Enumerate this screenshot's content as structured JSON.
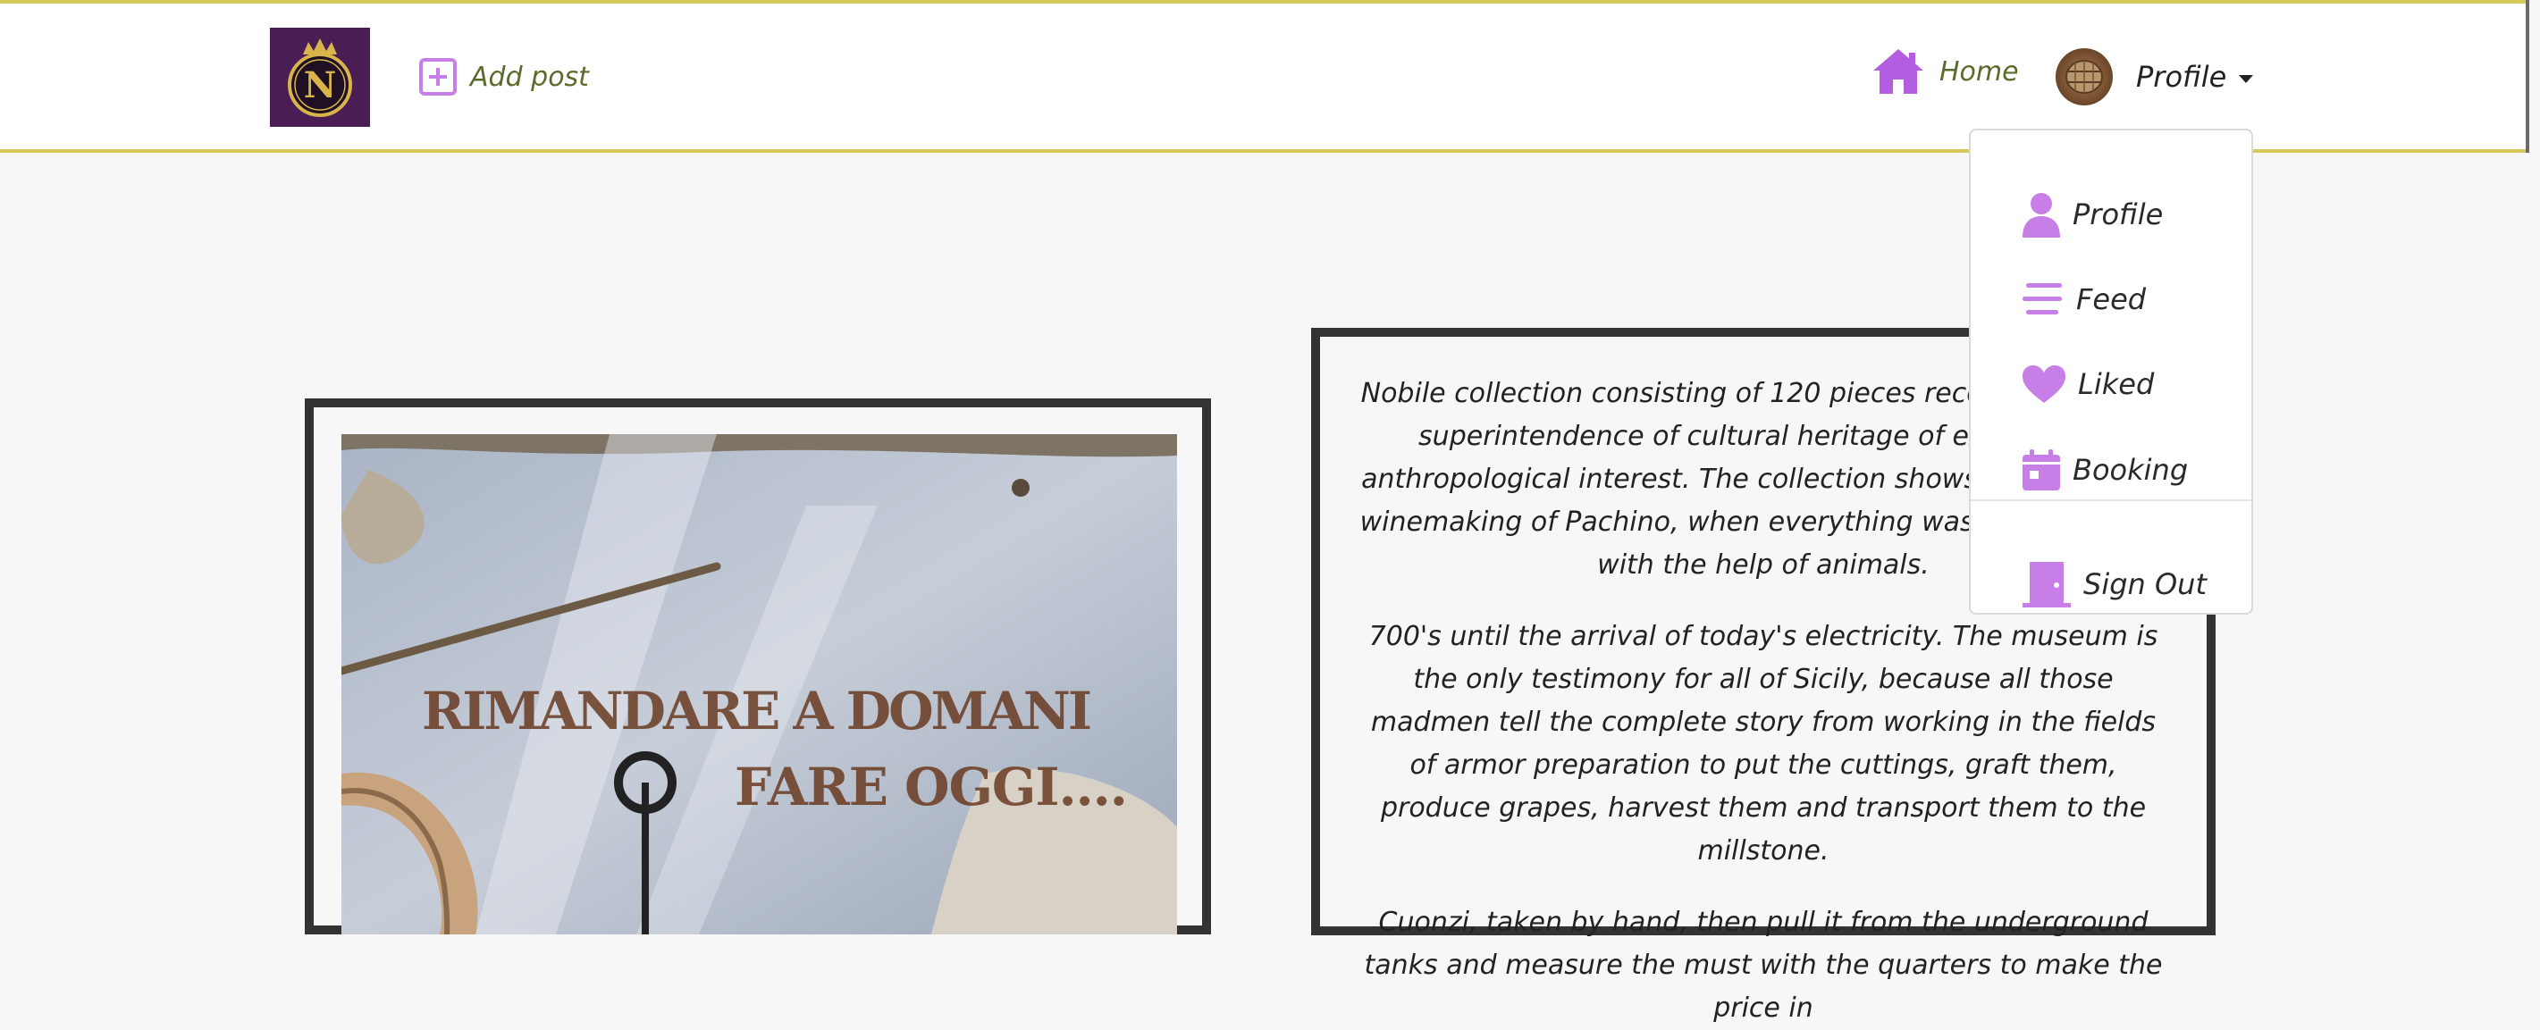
{
  "navbar": {
    "logo_letter": "N",
    "add_post_label": "Add post",
    "home_label": "Home",
    "profile_label": "Profile"
  },
  "dropdown": {
    "items": [
      {
        "label": "Profile",
        "icon": "user-icon"
      },
      {
        "label": "Feed",
        "icon": "feed-icon"
      },
      {
        "label": "Liked",
        "icon": "heart-icon"
      },
      {
        "label": "Booking",
        "icon": "calendar-icon"
      },
      {
        "label": "Sign Out",
        "icon": "door-icon"
      }
    ]
  },
  "post": {
    "photo_text_line1": "RIMANDARE A DOMANI",
    "photo_text_line2": "FARE OGGI....",
    "paragraphs": [
      "Nobile collection consisting of 120 pieces recognized by the superintendence of cultural heritage of exceptional anthropological interest. The collection shows the history of winemaking of Pachino, when everything was done by hand with the help of animals.",
      "700's until the arrival of today's electricity. The museum is the only testimony for all of Sicily, because all those madmen tell the complete story from working in the fields of armor preparation to put the cuttings, graft them, produce grapes, harvest them and transport them to the millstone.",
      "Cuonzi, taken by hand, then pull it from the underground tanks and measure the must with the quarters to make the price in"
    ]
  },
  "colors": {
    "accent_purple": "#b35ee0",
    "icon_purple": "#c77ee6",
    "nav_text_olive": "#5b6b2b",
    "navbar_border": "#d4c95a",
    "logo_bg": "#4a1d55"
  }
}
